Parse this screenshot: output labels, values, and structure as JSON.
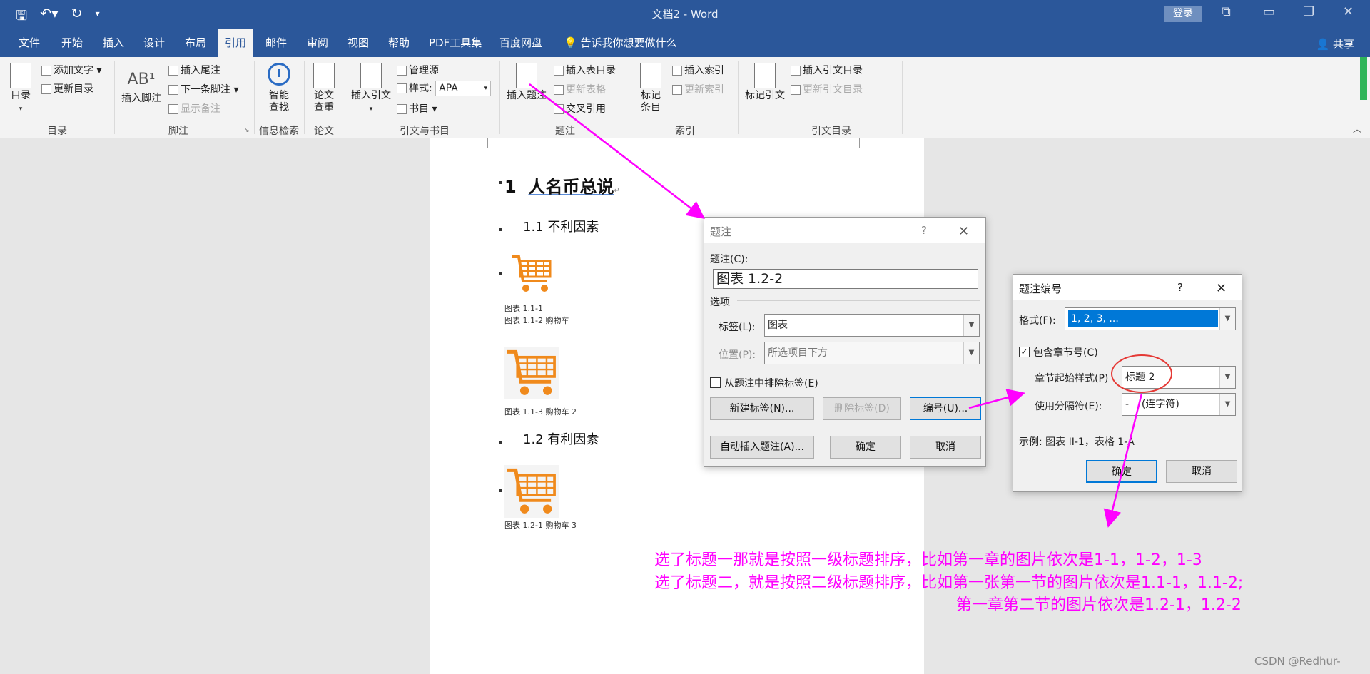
{
  "titlebar": {
    "doc_title": "文档2 - Word",
    "login_label": "登录"
  },
  "menu": {
    "tabs": [
      "文件",
      "开始",
      "插入",
      "设计",
      "布局",
      "引用",
      "邮件",
      "审阅",
      "视图",
      "帮助",
      "PDF工具集",
      "百度网盘"
    ],
    "active_tab": "引用",
    "tell_me": "告诉我你想要做什么",
    "share": "共享"
  },
  "ribbon": {
    "toc": {
      "button": "目录",
      "add_text": "添加文字",
      "update": "更新目录",
      "group": "目录"
    },
    "footnote": {
      "insert_footnote": "插入脚注",
      "insert_endnote": "插入尾注",
      "next_footnote": "下一条脚注",
      "show_notes": "显示备注",
      "group": "脚注"
    },
    "research": {
      "smart_lookup_1": "智能",
      "smart_lookup_2": "查找",
      "group": "信息检索"
    },
    "paper": {
      "check_1": "论文",
      "check_2": "查重",
      "group": "论文"
    },
    "citations": {
      "insert_citation": "插入引文",
      "manage_sources": "管理源",
      "style_label": "样式:",
      "style_value": "APA",
      "bibliography": "书目",
      "group": "引文与书目"
    },
    "captions": {
      "insert_caption": "插入题注",
      "insert_tof": "插入表目录",
      "update_table": "更新表格",
      "cross_ref": "交叉引用",
      "group": "题注"
    },
    "index": {
      "mark_entry_1": "标记",
      "mark_entry_2": "条目",
      "insert_index": "插入索引",
      "update_index": "更新索引",
      "group": "索引"
    },
    "toa": {
      "mark_citation": "标记引文",
      "insert_toa": "插入引文目录",
      "update_toa": "更新引文目录",
      "group": "引文目录"
    }
  },
  "document": {
    "h1_num": "1",
    "h1_text": "人名币总说",
    "h2_1": "1.1  不利因素",
    "cap_1": "图表 1.1-1",
    "cap_2": "图表 1.1-2 购物车",
    "cap_3": "图表 1.1-3 购物车 2",
    "h2_2": "1.2  有利因素",
    "cap_4": "图表 1.2-1 购物车 3"
  },
  "caption_dialog": {
    "title": "题注",
    "help": "?",
    "caption_label": "题注(C):",
    "caption_value": "图表 1.2-2",
    "options": "选项",
    "label_label": "标签(L):",
    "label_value": "图表",
    "position_label": "位置(P):",
    "position_value": "所选项目下方",
    "exclude_label": "从题注中排除标签(E)",
    "new_label": "新建标签(N)...",
    "delete_label": "删除标签(D)",
    "numbering": "编号(U)...",
    "autocaption": "自动插入题注(A)...",
    "ok": "确定",
    "cancel": "取消"
  },
  "numbering_dialog": {
    "title": "题注编号",
    "help": "?",
    "format_label": "格式(F):",
    "format_value": "1, 2, 3, ...",
    "include_chapter": "包含章节号(C)",
    "chapter_style_label": "章节起始样式(P)",
    "chapter_style_value": "标题 2",
    "separator_label": "使用分隔符(E):",
    "separator_value": "-    (连字符)",
    "example": "示例:  图表 II-1，表格 1-A",
    "ok": "确定",
    "cancel": "取消"
  },
  "annotation": {
    "line1": "选了标题一那就是按照一级标题排序，比如第一章的图片依次是1-1，1-2，1-3",
    "line2": "选了标题二，就是按照二级标题排序，比如第一张第一节的图片依次是1.1-1，1.1-2;",
    "line3": "第一章第二节的图片依次是1.2-1，1.2-2",
    "color": "#ff00ff"
  },
  "watermark": "CSDN @Redhur-"
}
